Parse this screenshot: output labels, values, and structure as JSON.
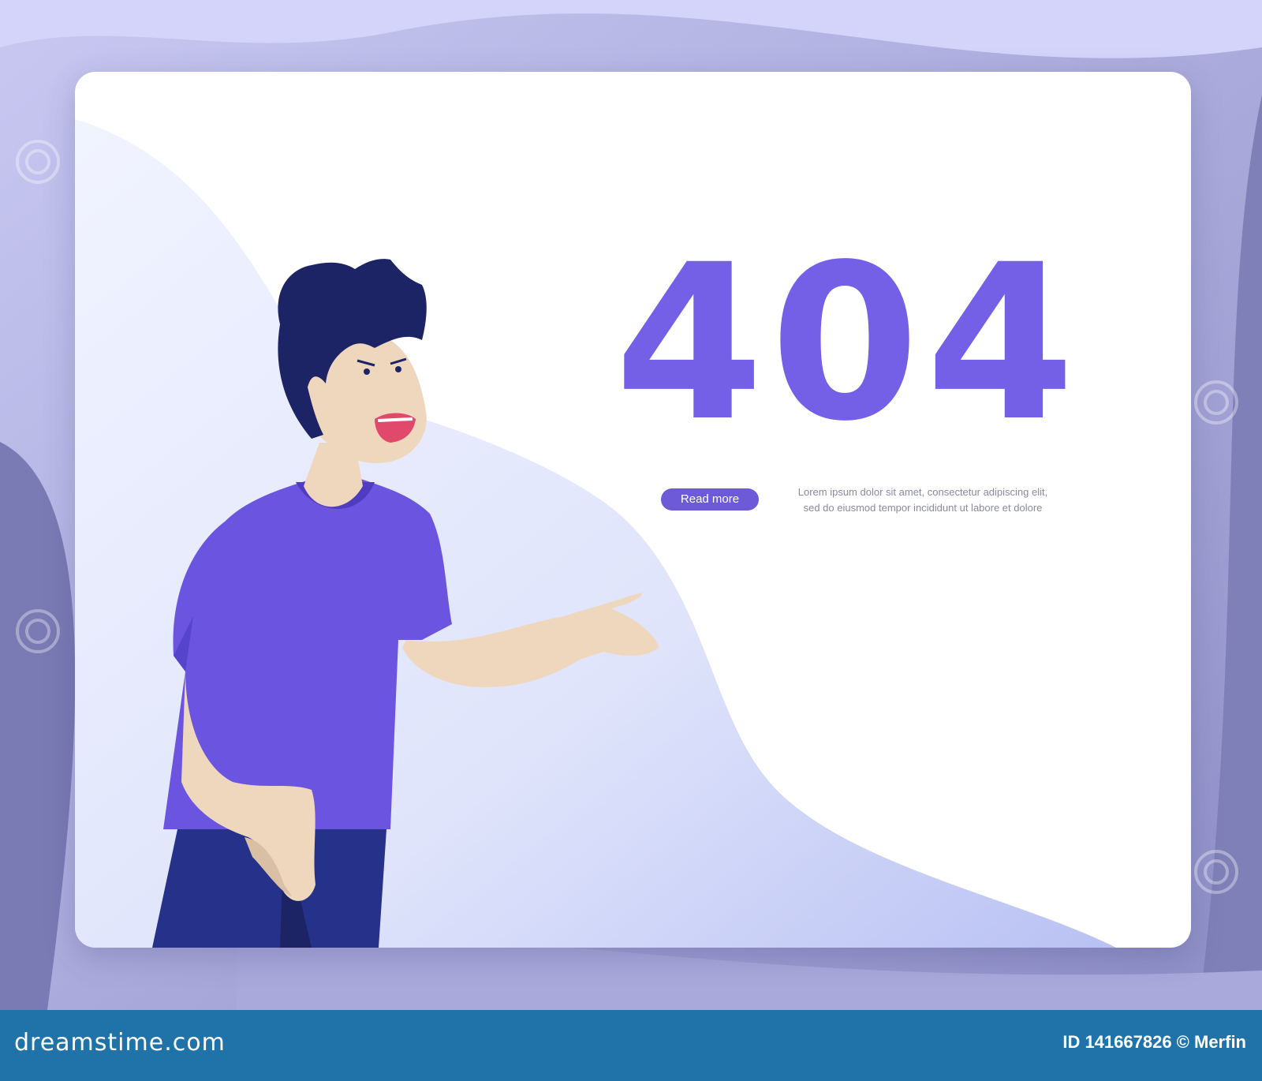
{
  "error": {
    "code": "404",
    "read_more_label": "Read more",
    "description_lines": [
      "Lorem ipsum dolor sit amet, consectetur adipiscing elit,",
      "sed do eiusmod tempor incididunt ut labore et dolore"
    ]
  },
  "footer": {
    "brand": "dreamstime.com",
    "image_id": "ID 141667826 © Merfin"
  },
  "colors": {
    "accent": "#7360e6",
    "button": "#6d5ad8",
    "shirt": "#6b55e0",
    "hair": "#1c2466",
    "skin": "#efd7be",
    "background": "#b9b9e6",
    "footer": "#1f73a8"
  },
  "illustration": "angry-man-pointing"
}
